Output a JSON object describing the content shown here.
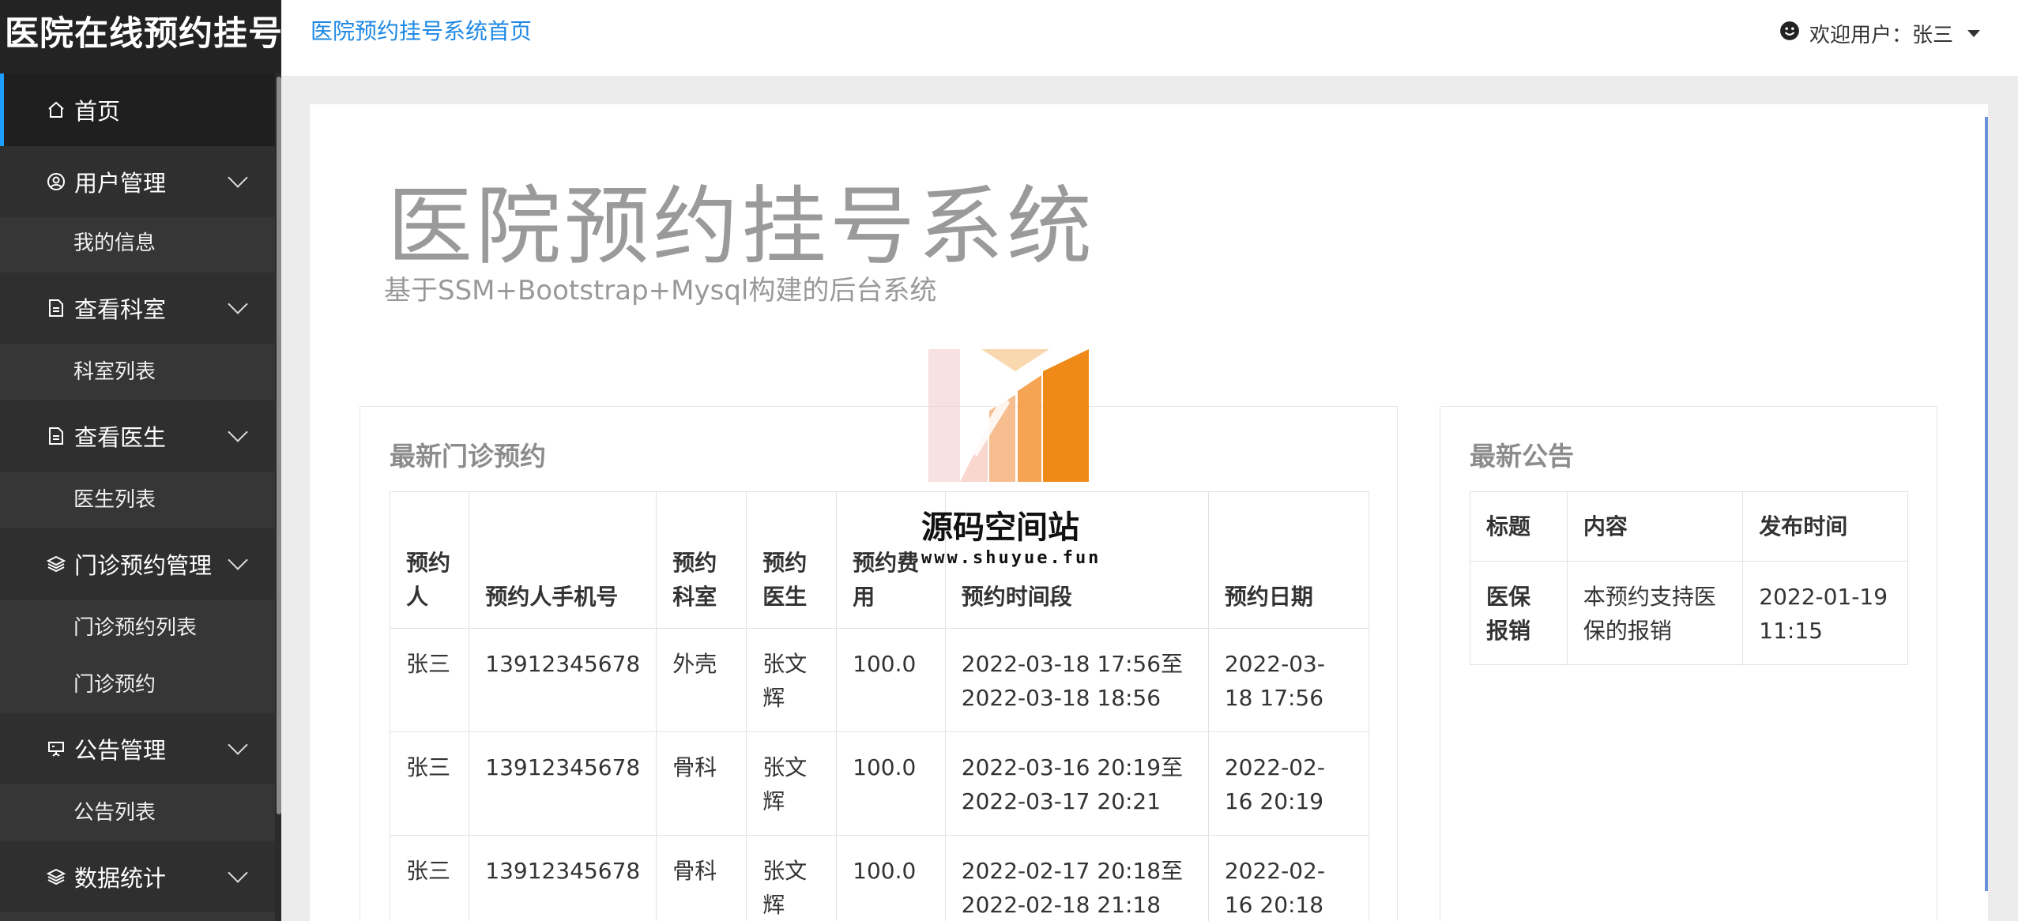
{
  "brand": "医院在线预约挂号",
  "header": {
    "home_link": "医院预约挂号系统首页",
    "welcome": "欢迎用户：张三"
  },
  "sidebar": {
    "home": "首页",
    "user_mgmt": "用户管理",
    "my_info": "我的信息",
    "view_dept": "查看科室",
    "dept_list": "科室列表",
    "view_doctor": "查看医生",
    "doctor_list": "医生列表",
    "appt_mgmt": "门诊预约管理",
    "appt_list": "门诊预约列表",
    "appt": "门诊预约",
    "notice_mgmt": "公告管理",
    "notice_list": "公告列表",
    "stats": "数据统计"
  },
  "jumbotron": {
    "title": "医院预约挂号系统",
    "subtitle": "基于SSM+Bootstrap+Mysql构建的后台系统"
  },
  "appointments": {
    "title": "最新门诊预约",
    "headers": [
      "预约人",
      "预约人手机号",
      "预约科室",
      "预约医生",
      "预约费用",
      "预约时间段",
      "预约日期"
    ],
    "rows": [
      [
        "张三",
        "13912345678",
        "外壳",
        "张文辉",
        "100.0",
        "2022-03-18 17:56至2022-03-18 18:56",
        "2022-03-18 17:56"
      ],
      [
        "张三",
        "13912345678",
        "骨科",
        "张文辉",
        "100.0",
        "2022-03-16 20:19至2022-03-17 20:21",
        "2022-02-16 20:19"
      ],
      [
        "张三",
        "13912345678",
        "骨科",
        "张文辉",
        "100.0",
        "2022-02-17 20:18至2022-02-18 21:18",
        "2022-02-16 20:18"
      ]
    ]
  },
  "notices": {
    "title": "最新公告",
    "headers": [
      "标题",
      "内容",
      "发布时间"
    ],
    "rows": [
      [
        "医保报销",
        "本预约支持医保的报销",
        "2022-01-19 11:15"
      ]
    ]
  },
  "watermark": {
    "name": "源码空间站",
    "url": "www.shuyue.fun"
  },
  "colors": {
    "accent": "#1e9fff",
    "link": "#1e88e5",
    "sidebar_bg": "#363636",
    "brand_bg": "#232323"
  }
}
